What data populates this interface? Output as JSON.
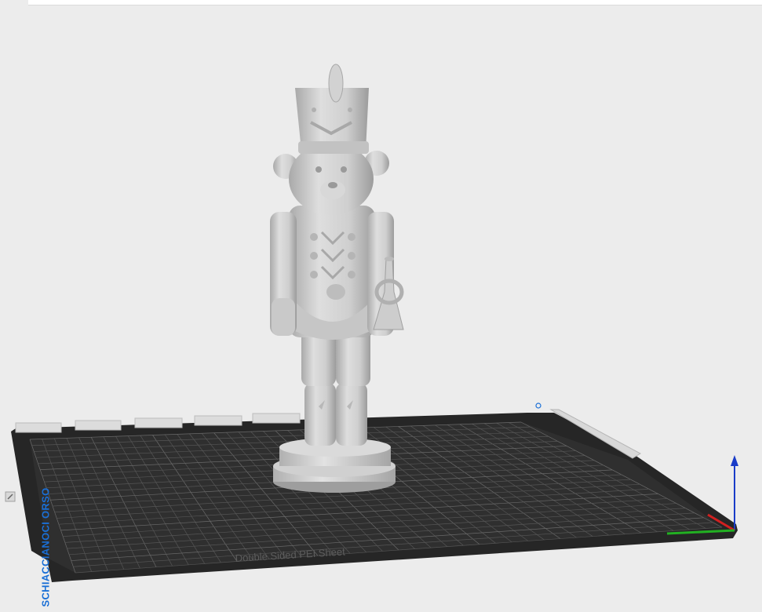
{
  "scene": {
    "object_name": "SCHIACCIANOCI ORSO",
    "bed_sheet_label": "Double Sided PEI Sheet",
    "model_description": "nutcracker-bear-model"
  },
  "axes": {
    "x_color": "#d12020",
    "y_color": "#22b022",
    "z_color": "#1a3cc8"
  },
  "colors": {
    "background": "#ececec",
    "bed": "#2a2a2a",
    "grid": "#4a4a4a",
    "model": "#cfcfcf",
    "accent": "#1a6fd6"
  }
}
